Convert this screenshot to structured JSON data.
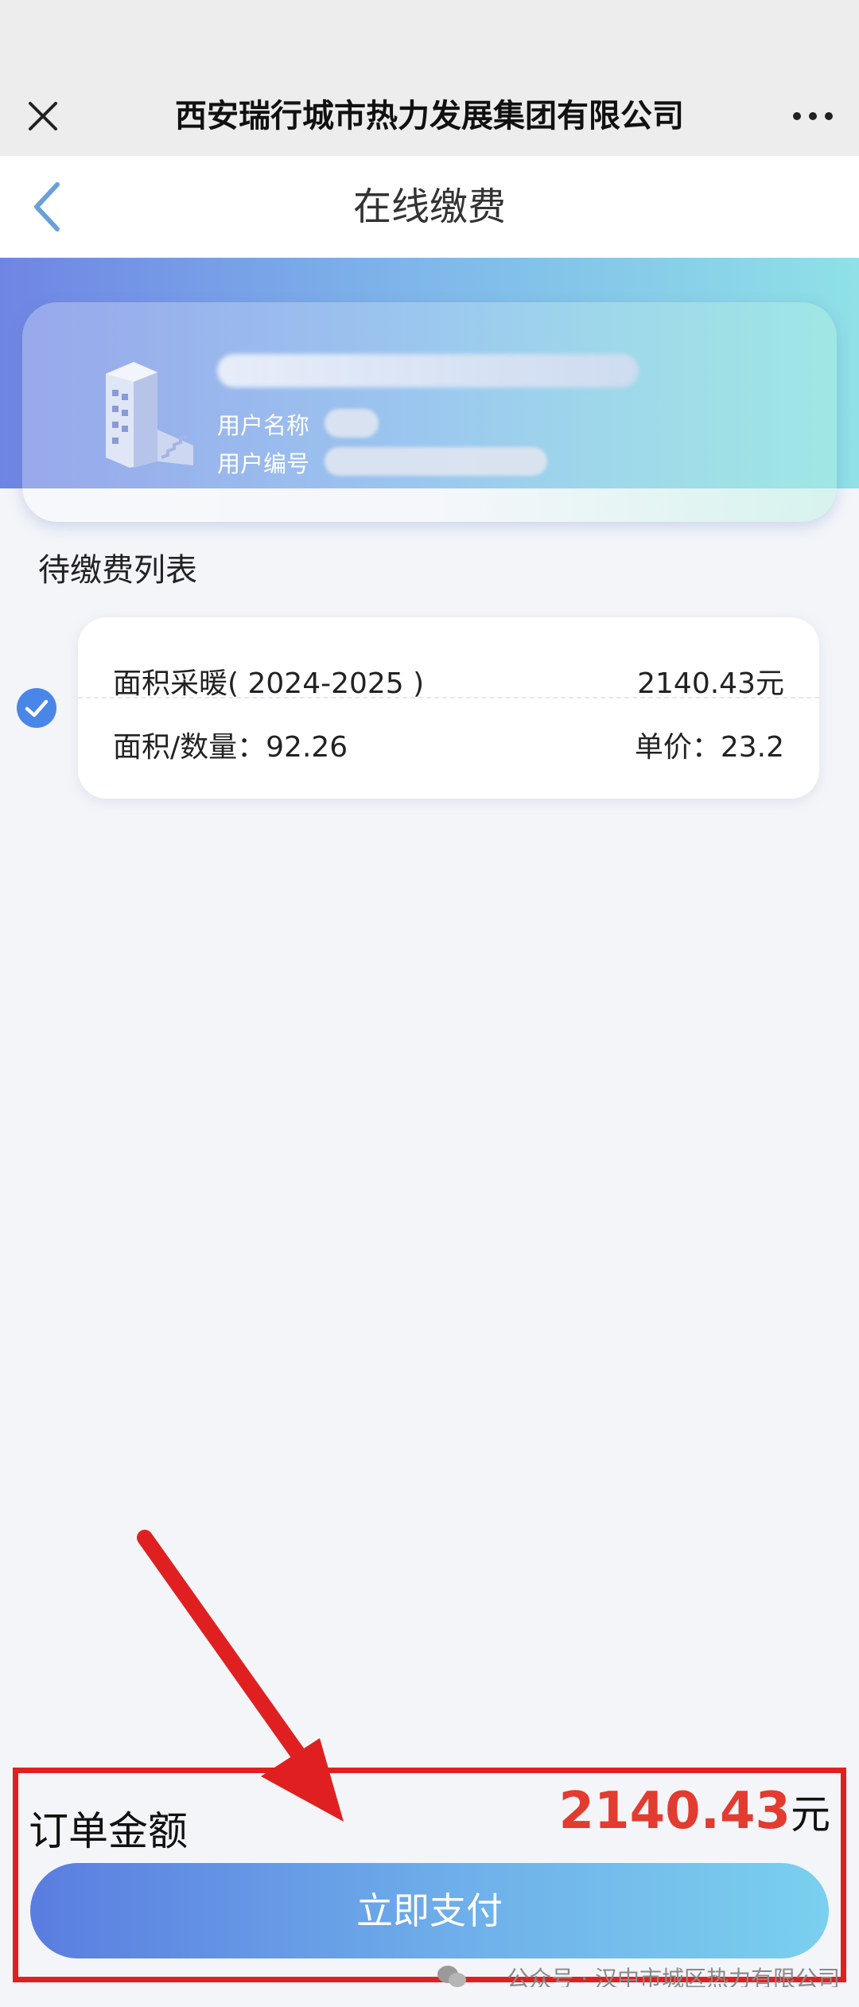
{
  "window": {
    "app_title": "西安瑞行城市热力发展集团有限公司"
  },
  "page": {
    "title": "在线缴费"
  },
  "user_card": {
    "name_label": "用户名称",
    "id_label": "用户编号"
  },
  "bill_list": {
    "section_title": "待缴费列表",
    "items": [
      {
        "item_name": "面积采暖( 2024-2025 )",
        "item_amount": "2140.43元",
        "area_text": "面积/数量：92.26",
        "price_text": "单价：23.2",
        "selected": true
      }
    ]
  },
  "footer": {
    "total_label": "订单金额",
    "total_amount": "2140.43",
    "currency": "元",
    "pay_button_label": "立即支付"
  },
  "watermark": {
    "text": "公众号 · 汉中市城区热力有限公司"
  },
  "colors": {
    "accent_blue": "#4a86e8",
    "amount_red": "#e23b2f",
    "highlight_red": "#e02020"
  }
}
